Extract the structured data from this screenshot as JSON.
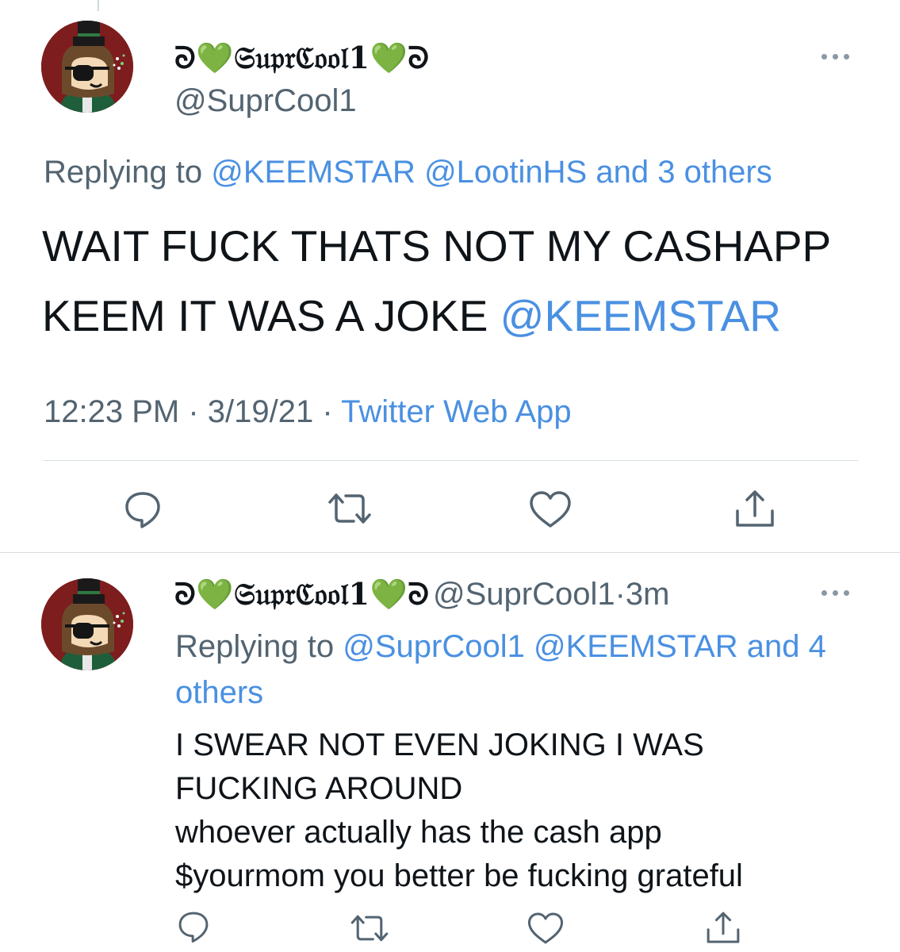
{
  "main_tweet": {
    "display_name": "ᘐ💚𝔖𝔲𝔭𝔯ℭ𝔬𝔬𝔩1💚ᘐ",
    "handle": "@SuprCool1",
    "replying_prefix": "Replying to",
    "replying_to": [
      "@KEEMSTAR",
      "@LootinHS"
    ],
    "replying_and": "and",
    "replying_others": "3 others",
    "text_line1": "WAIT FUCK THATS NOT MY CASHAPP",
    "text_line2": "KEEM IT WAS A JOKE",
    "text_mention": "@KEEMSTAR",
    "time": "12:23 PM",
    "separator": "·",
    "date": "3/19/21",
    "source": "Twitter Web App"
  },
  "reply_tweet": {
    "display_name": "ᘐ💚𝔖𝔲𝔭𝔯ℭ𝔬𝔬𝔩1💚ᘐ",
    "handle": "@SuprCool1",
    "separator": "·",
    "age": "3m",
    "replying_prefix": "Replying to",
    "replying_to": [
      "@SuprCool1",
      "@KEEMSTAR"
    ],
    "replying_and": "and 4",
    "replying_others": "others",
    "lines": [
      "I SWEAR NOT EVEN JOKING I WAS",
      "FUCKING AROUND",
      "whoever actually has the cash app",
      "$yourmom you better be fucking grateful"
    ]
  },
  "icons": {
    "reply": "reply-icon",
    "retweet": "retweet-icon",
    "like": "heart-icon",
    "share": "share-icon",
    "more": "more-icon"
  },
  "colors": {
    "link": "#4a90e2",
    "muted": "#536471",
    "text": "#0f1419",
    "avatar_bg": "#7d1d1e",
    "name_heart": "#5fd13a"
  }
}
